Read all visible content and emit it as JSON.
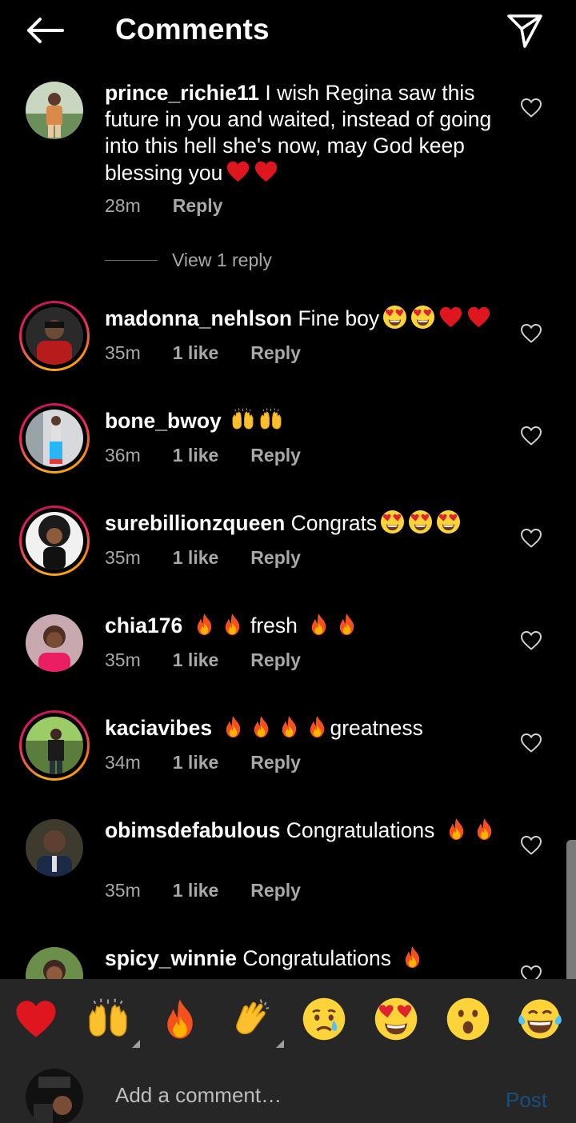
{
  "header": {
    "title": "Comments"
  },
  "comments": [
    {
      "user": "prince_richie11",
      "text": "I wish Regina saw this future in you and waited, instead of going into this hell she's now, may God keep blessing you",
      "emojis": [
        "heart",
        "heart"
      ],
      "time": "28m",
      "likes": "",
      "reply": "Reply",
      "view_replies": "View 1 reply"
    },
    {
      "user": "madonna_nehlson",
      "text": "Fine boy",
      "emojis": [
        "heart-eyes",
        "heart-eyes",
        "heart",
        "heart"
      ],
      "time": "35m",
      "likes": "1 like",
      "reply": "Reply"
    },
    {
      "user": "bone_bwoy",
      "text": "",
      "emojis": [
        "raised-hands",
        "raised-hands"
      ],
      "time": "36m",
      "likes": "1 like",
      "reply": "Reply"
    },
    {
      "user": "surebillionzqueen",
      "text": "Congrats",
      "emojis": [
        "heart-eyes",
        "heart-eyes",
        "heart-eyes"
      ],
      "time": "35m",
      "likes": "1 like",
      "reply": "Reply"
    },
    {
      "user": "chia176",
      "text": "fresh",
      "emojis": [
        "fire",
        "fire",
        "fire",
        "fire"
      ],
      "time": "35m",
      "likes": "1 like",
      "reply": "Reply"
    },
    {
      "user": "kaciavibes",
      "text": "greatness",
      "emojis": [
        "fire",
        "fire",
        "fire",
        "fire"
      ],
      "time": "34m",
      "likes": "1 like",
      "reply": "Reply"
    },
    {
      "user": "obimsdefabulous",
      "text": "Congratulations",
      "emojis": [
        "fire",
        "fire"
      ],
      "time": "35m",
      "likes": "1 like",
      "reply": "Reply"
    },
    {
      "user": "spicy_winnie",
      "text": "Congratulations",
      "emojis": [
        "fire"
      ],
      "time": "",
      "likes": "",
      "reply": ""
    }
  ],
  "quick_emojis": [
    "heart",
    "raised-hands",
    "fire",
    "clapping-hands",
    "crying-face",
    "heart-eyes",
    "surprised-face",
    "tears-of-joy"
  ],
  "composer": {
    "placeholder": "Add a comment…",
    "post": "Post"
  },
  "colors": {
    "background": "#000000",
    "bar": "#262626",
    "meta_text": "#a8a8a8",
    "post_disabled": "#1a4f7a"
  }
}
